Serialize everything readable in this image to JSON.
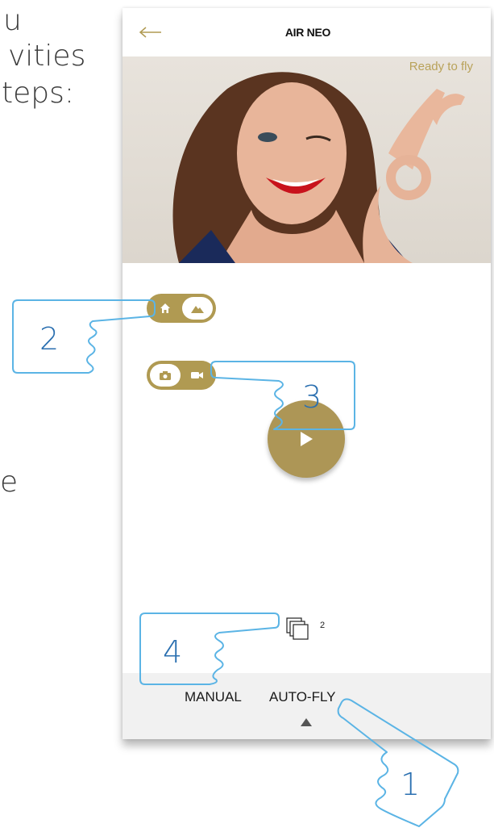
{
  "background_text": {
    "line1": "u",
    "line2": "vities",
    "line3": "teps:",
    "line4": "e"
  },
  "app": {
    "title": "AIR NEO",
    "back_icon": "arrow-left-icon"
  },
  "preview": {
    "status": "Ready to fly"
  },
  "toggles": {
    "location": {
      "left_icon": "home-icon",
      "right_icon": "landscape-icon",
      "selected": "landscape"
    },
    "capture": {
      "left_icon": "camera-icon",
      "right_icon": "video-icon",
      "selected": "camera"
    }
  },
  "play": {
    "icon": "play-icon"
  },
  "gallery": {
    "icon": "stacked-photos-icon",
    "count": "2"
  },
  "tabs": {
    "manual": "MANUAL",
    "autofly": "AUTO-FLY",
    "active": "AUTO-FLY"
  },
  "callouts": [
    "2",
    "3",
    "4",
    "1"
  ],
  "colors": {
    "accent": "#b09a52",
    "callout": "#5bb4e5",
    "tabbar": "#f1f1f1"
  }
}
